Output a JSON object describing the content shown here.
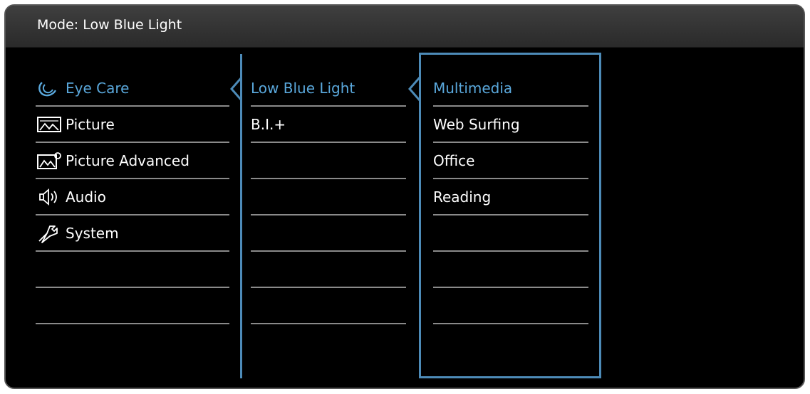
{
  "header": {
    "mode_label": "Mode:",
    "mode_value": "Low Blue Light"
  },
  "main_menu": [
    {
      "label": "Eye Care",
      "icon": "eye-care-icon",
      "selected": true
    },
    {
      "label": "Picture",
      "icon": "picture-icon",
      "selected": false
    },
    {
      "label": "Picture Advanced",
      "icon": "picture-advanced-icon",
      "selected": false
    },
    {
      "label": "Audio",
      "icon": "audio-icon",
      "selected": false
    },
    {
      "label": "System",
      "icon": "system-icon",
      "selected": false
    },
    {
      "label": ""
    },
    {
      "label": ""
    }
  ],
  "sub_menu": [
    {
      "label": "Low Blue Light",
      "selected": true
    },
    {
      "label": "B.I.+",
      "selected": false
    },
    {
      "label": ""
    },
    {
      "label": ""
    },
    {
      "label": ""
    },
    {
      "label": ""
    },
    {
      "label": ""
    }
  ],
  "options_menu": [
    {
      "label": "Multimedia",
      "selected": true
    },
    {
      "label": "Web Surfing",
      "selected": false
    },
    {
      "label": "Office",
      "selected": false
    },
    {
      "label": "Reading",
      "selected": false
    },
    {
      "label": ""
    },
    {
      "label": ""
    },
    {
      "label": ""
    }
  ],
  "colors": {
    "accent": "#5aa8dc",
    "divider": "#4d8bb8",
    "text": "#ffffff",
    "background": "#000000"
  }
}
